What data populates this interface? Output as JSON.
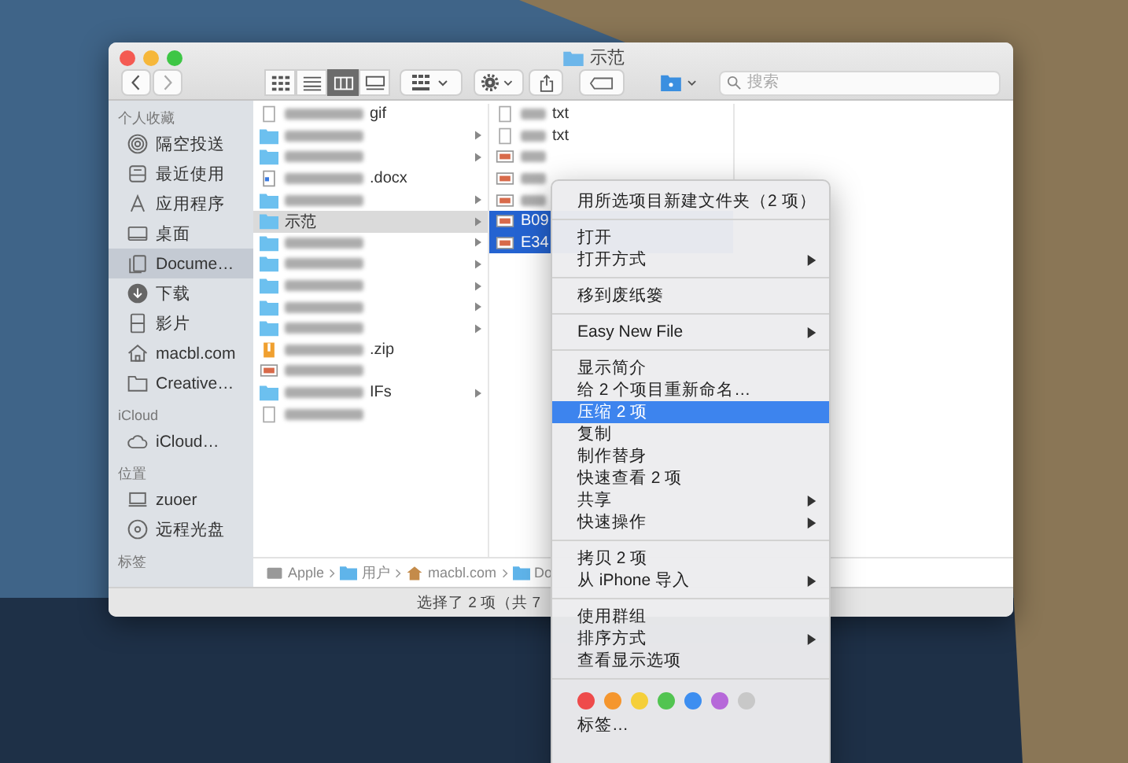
{
  "window": {
    "title": "示范"
  },
  "toolbar": {
    "view_modes": [
      {
        "selected": false
      },
      {
        "selected": false
      },
      {
        "selected": true
      },
      {
        "selected": false
      }
    ],
    "search": {
      "placeholder": "搜索"
    }
  },
  "sidebar": {
    "groups": [
      {
        "title": "个人收藏",
        "items": [
          {
            "label": "隔空投送",
            "selected": false
          },
          {
            "label": "最近使用",
            "selected": false
          },
          {
            "label": "应用程序",
            "selected": false
          },
          {
            "label": "桌面",
            "selected": false
          },
          {
            "label": "Docume…",
            "selected": true
          },
          {
            "label": "下载",
            "selected": false
          },
          {
            "label": "影片",
            "selected": false
          },
          {
            "label": "macbl.com",
            "selected": false
          },
          {
            "label": "Creative…",
            "selected": false
          }
        ]
      },
      {
        "title": "iCloud",
        "items": [
          {
            "label": "iCloud…",
            "selected": false
          }
        ]
      },
      {
        "title": "位置",
        "items": [
          {
            "label": "zuoer",
            "selected": false
          },
          {
            "label": "远程光盘",
            "selected": false
          }
        ]
      },
      {
        "title": "标签"
      }
    ]
  },
  "columns": [
    {
      "rows": [
        {
          "label": "gif",
          "kind": "file",
          "blurred": true,
          "selected": false
        },
        {
          "kind": "folder",
          "blurred": true,
          "selected": false
        },
        {
          "kind": "folder",
          "blurred": true,
          "selected": false
        },
        {
          "label": ".docx",
          "kind": "document",
          "blurred": true,
          "selected": false
        },
        {
          "kind": "folder",
          "blurred": true,
          "selected": false
        },
        {
          "label": "示范",
          "kind": "folder",
          "blurred": false,
          "selected": true
        },
        {
          "kind": "folder",
          "blurred": true,
          "selected": false
        },
        {
          "kind": "folder",
          "blurred": true,
          "selected": false
        },
        {
          "kind": "folder",
          "blurred": true,
          "selected": false
        },
        {
          "kind": "folder",
          "blurred": true,
          "selected": false
        },
        {
          "kind": "folder",
          "blurred": true,
          "selected": false
        },
        {
          "label": ".zip",
          "kind": "archive",
          "blurred": true,
          "selected": false
        },
        {
          "kind": "image",
          "blurred": true,
          "selected": false
        },
        {
          "label": "IFs",
          "kind": "folder",
          "blurred": true,
          "selected": false
        },
        {
          "kind": "file",
          "blurred": true,
          "selected": false
        }
      ]
    },
    {
      "rows": [
        {
          "label": "txt",
          "kind": "file",
          "blurred": true,
          "selected": false
        },
        {
          "label": "txt",
          "kind": "file",
          "blurred": true,
          "selected": false
        },
        {
          "kind": "image",
          "blurred": true,
          "selected": false
        },
        {
          "kind": "image",
          "blurred": true,
          "selected": false
        },
        {
          "kind": "image",
          "blurred": true,
          "selected": false
        },
        {
          "label": "B09",
          "kind": "image",
          "blurred": false,
          "selected": true
        },
        {
          "label": "E34",
          "kind": "image",
          "blurred": false,
          "selected": true
        }
      ]
    }
  ],
  "path_bar": [
    {
      "label": "Apple",
      "kind": "disk"
    },
    {
      "label": "用户",
      "kind": "folder"
    },
    {
      "label": "macbl.com",
      "kind": "home"
    },
    {
      "label": "Do",
      "kind": "folder"
    }
  ],
  "status_bar": "选择了 2 项（共 7",
  "context_menu": {
    "sections": [
      {
        "items": [
          {
            "label": "用所选项目新建文件夹（2 项）",
            "submenu": false,
            "selected": false
          }
        ]
      },
      {
        "items": [
          {
            "label": "打开",
            "submenu": false,
            "selected": false
          },
          {
            "label": "打开方式",
            "submenu": true,
            "selected": false
          }
        ]
      },
      {
        "items": [
          {
            "label": "移到废纸篓",
            "submenu": false,
            "selected": false
          }
        ]
      },
      {
        "items": [
          {
            "label": "Easy New File",
            "submenu": true,
            "selected": false
          }
        ]
      },
      {
        "items": [
          {
            "label": "显示简介",
            "submenu": false,
            "selected": false
          },
          {
            "label": "给 2 个项目重新命名…",
            "submenu": false,
            "selected": false
          },
          {
            "label": "压缩 2 项",
            "submenu": false,
            "selected": true
          },
          {
            "label": "复制",
            "submenu": false,
            "selected": false
          },
          {
            "label": "制作替身",
            "submenu": false,
            "selected": false
          },
          {
            "label": "快速查看 2 项",
            "submenu": false,
            "selected": false
          },
          {
            "label": "共享",
            "submenu": true,
            "selected": false
          },
          {
            "label": "快速操作",
            "submenu": true,
            "selected": false
          }
        ]
      },
      {
        "items": [
          {
            "label": "拷贝 2 项",
            "submenu": false,
            "selected": false
          },
          {
            "label": "从 iPhone 导入",
            "submenu": true,
            "selected": false
          }
        ]
      },
      {
        "items": [
          {
            "label": "使用群组",
            "submenu": false,
            "selected": false
          },
          {
            "label": "排序方式",
            "submenu": true,
            "selected": false
          },
          {
            "label": "查看显示选项",
            "submenu": false,
            "selected": false
          }
        ]
      },
      {
        "tag_colors": [
          {
            "color": "#ee4b4b"
          },
          {
            "color": "#f5962e"
          },
          {
            "color": "#f5cf3a"
          },
          {
            "color": "#52c451"
          },
          {
            "color": "#3d8ef0"
          },
          {
            "color": "#b668d9"
          },
          {
            "color": "#c8c8c8"
          }
        ],
        "items": [
          {
            "label": "标签…",
            "submenu": false,
            "selected": false
          }
        ]
      }
    ]
  }
}
